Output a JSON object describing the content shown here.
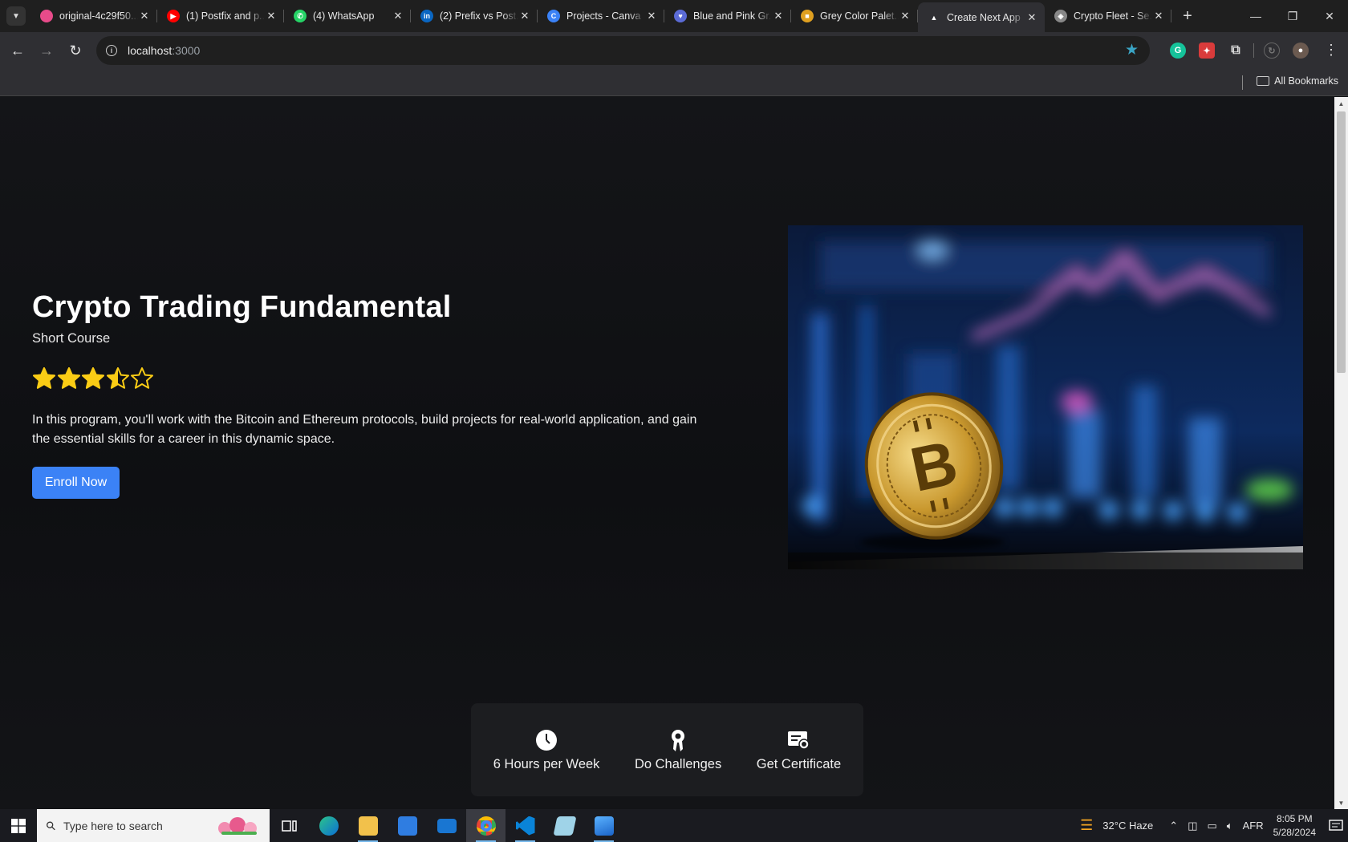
{
  "browser": {
    "tabs": [
      {
        "title": "original-4c29f50...",
        "favicon_color": "#e84b8a",
        "favicon_glyph": ""
      },
      {
        "title": "(1) Postfix and p...",
        "favicon_color": "#ff0000",
        "favicon_glyph": "▶"
      },
      {
        "title": "(4) WhatsApp",
        "favicon_color": "#25d366",
        "favicon_glyph": "✆"
      },
      {
        "title": "(2) Prefix vs Post...",
        "favicon_color": "#0a66c2",
        "favicon_glyph": "in"
      },
      {
        "title": "Projects - Canva",
        "favicon_color": "#3b82f6",
        "favicon_glyph": "C"
      },
      {
        "title": "Blue and Pink Gr...",
        "favicon_color": "#5b6bd6",
        "favicon_glyph": "♥"
      },
      {
        "title": "Grey Color Palet...",
        "favicon_color": "#e0a020",
        "favicon_glyph": "■"
      },
      {
        "title": "Create Next App",
        "favicon_color": "#ffffff",
        "favicon_glyph": "▲",
        "active": true
      },
      {
        "title": "Crypto Fleet - Se...",
        "favicon_color": "#888888",
        "favicon_glyph": "◈"
      }
    ],
    "url_host": "localhost",
    "url_port": ":3000",
    "bookmarks_label": "All Bookmarks"
  },
  "page": {
    "title": "Crypto Trading Fundamental",
    "subtitle": "Short Course",
    "rating": 3.5,
    "rating_max": 5,
    "star_color": "#facc15",
    "description": "In this program, you'll work with the Bitcoin and Ethereum protocols, build projects for real-world application, and gain the essential skills for a career in this dynamic space.",
    "enroll_label": "Enroll Now",
    "accent": "#3b82f6",
    "features": [
      {
        "icon": "clock-icon",
        "label": "6 Hours per Week"
      },
      {
        "icon": "medal-icon",
        "label": "Do Challenges"
      },
      {
        "icon": "certificate-icon",
        "label": "Get Certificate"
      }
    ]
  },
  "taskbar": {
    "search_placeholder": "Type here to search",
    "weather": "32°C  Haze",
    "language": "AFR",
    "time": "8:05 PM",
    "date": "5/28/2024"
  }
}
